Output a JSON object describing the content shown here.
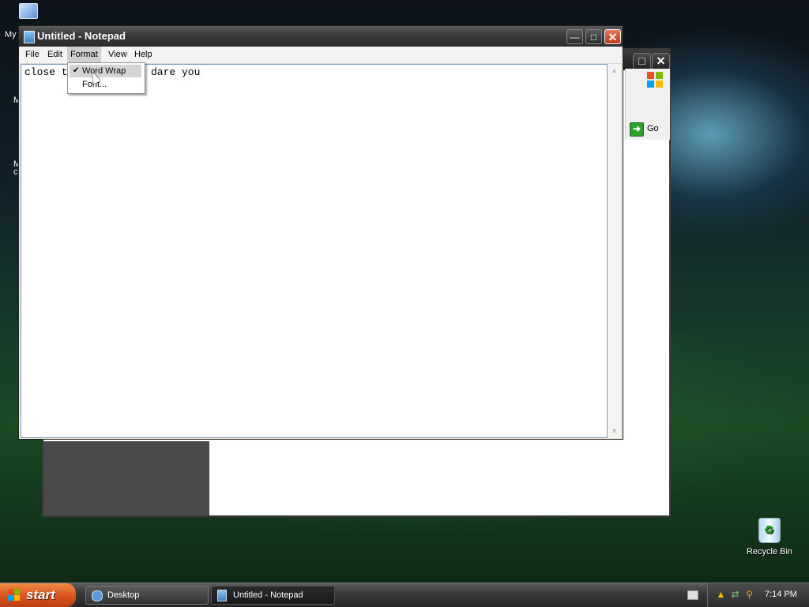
{
  "desktop": {
    "my_computer_label": "My",
    "peek_label_1": "M",
    "peek_label_2": "M\nc",
    "recycle_bin_label": "Recycle Bin"
  },
  "background_window": {
    "go_label": "Go",
    "colors": {
      "side_panel": "#4a4a4a",
      "go_arrow": "#2ea02e"
    }
  },
  "notepad": {
    "title": "Untitled - Notepad",
    "menu": [
      "File",
      "Edit",
      "Format",
      "View",
      "Help"
    ],
    "active_menu": "Format",
    "text_visible_start": "close t",
    "text_visible_end": "dare you",
    "format_menu": {
      "items": [
        {
          "label": "Word Wrap",
          "checked": true,
          "highlighted": true
        },
        {
          "label": "Font...",
          "checked": false,
          "highlighted": false
        }
      ]
    }
  },
  "taskbar": {
    "start_label": "start",
    "tasks": [
      {
        "label": "Desktop",
        "icon": "ie-icon",
        "active": false
      },
      {
        "label": "Untitled - Notepad",
        "icon": "notepad-icon",
        "active": true
      }
    ],
    "clock": "7:14 PM",
    "tray_icons": [
      "keyboard-icon",
      "security-shield-icon",
      "network-icon",
      "search-icon"
    ]
  }
}
